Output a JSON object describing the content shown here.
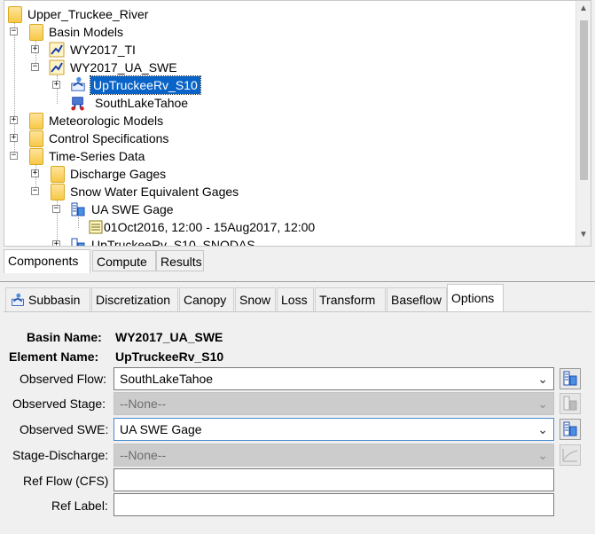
{
  "tree": {
    "root": "Upper_Truckee_River",
    "basin_models": "Basin Models",
    "wy2017_ti": "WY2017_TI",
    "wy2017_ua_swe": "WY2017_UA_SWE",
    "subbasin_selected": "UpTruckeeRv_S10",
    "junction": "SouthLakeTahoe",
    "meteorologic_models": "Meteorologic Models",
    "control_specifications": "Control Specifications",
    "time_series_data": "Time-Series Data",
    "discharge_gages": "Discharge Gages",
    "swe_gages": "Snow Water Equivalent Gages",
    "ua_swe_gage": "UA SWE Gage",
    "time_window": "01Oct2016, 12:00 - 15Aug2017, 12:00",
    "partial_item": "UpTruckeeRv_S10_SNODAS"
  },
  "tree_tabs": {
    "components": "Components",
    "compute": "Compute",
    "results": "Results"
  },
  "editor_tabs": {
    "subbasin": "Subbasin",
    "discretization": "Discretization",
    "canopy": "Canopy",
    "snow": "Snow",
    "loss": "Loss",
    "transform": "Transform",
    "baseflow": "Baseflow",
    "options": "Options"
  },
  "form": {
    "basin_name_label": "Basin Name:",
    "basin_name_value": "WY2017_UA_SWE",
    "element_name_label": "Element Name:",
    "element_name_value": "UpTruckeeRv_S10",
    "observed_flow_label": "Observed Flow:",
    "observed_flow_value": "SouthLakeTahoe",
    "observed_stage_label": "Observed Stage:",
    "observed_stage_value": "--None--",
    "observed_swe_label": "Observed SWE:",
    "observed_swe_value": "UA SWE Gage",
    "stage_discharge_label": "Stage-Discharge:",
    "stage_discharge_value": "--None--",
    "ref_flow_label": "Ref Flow (CFS)",
    "ref_flow_value": "",
    "ref_label_label": "Ref Label:",
    "ref_label_value": ""
  },
  "colors": {
    "selection": "#0a64c8",
    "folder": "#f7c948",
    "disabled_field": "#cccccc"
  }
}
